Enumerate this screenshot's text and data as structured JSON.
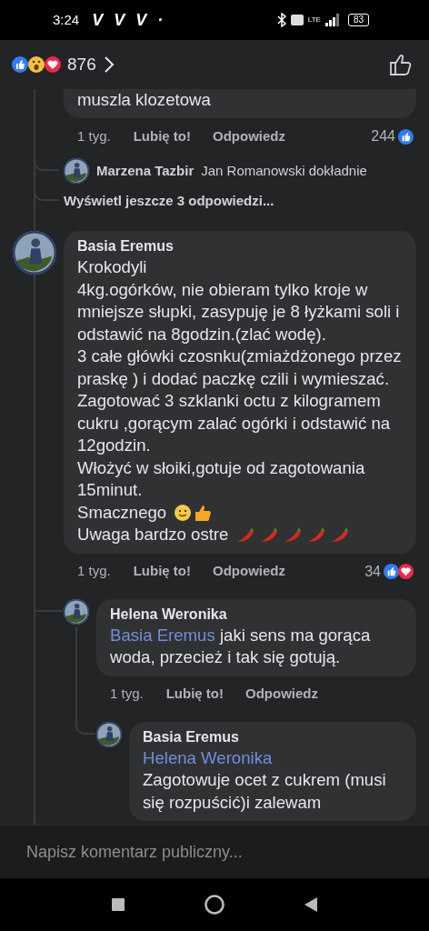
{
  "status_bar": {
    "time": "3:24",
    "notifications": [
      "V",
      "V",
      "V",
      "·"
    ],
    "battery": "83",
    "network": "LTE"
  },
  "header": {
    "reaction_count": "876"
  },
  "previous_replies": [
    {
      "kind": "tail",
      "lines": [
        {
          "text": "muszla klozetowa"
        }
      ],
      "time": "1 tyg.",
      "like": "Lubię to!",
      "reply": "Odpowiedz",
      "reactions_count": "244",
      "reactions": [
        {
          "kind": "like"
        }
      ]
    },
    {
      "kind": "inline",
      "author": "Marzena Tazbir",
      "text": "Jan Romanowski dokładnie"
    },
    {
      "kind": "more",
      "text": "Wyświetl jeszcze 3 odpowiedzi..."
    }
  ],
  "comments": [
    {
      "kind": "full",
      "author": "Basia Eremus",
      "lines": [
        {
          "text": "Krokodyli"
        },
        {
          "text": "4kg.ogórków, nie obieram tylko kroje w mniejsze słupki, zasypuję je 8 łyżkami soli i odstawić na 8godzin.(zlać wodę)."
        },
        {
          "text": "3 całe główki czosnku(zmiażdżonego przez praskę ) i dodać paczkę czili i wymieszać."
        },
        {
          "text": "Zagotować 3 szklanki octu z kilogramem cukru ,gorącym zalać ogórki i odstawić na 12godzin."
        },
        {
          "text": "Włożyć w słoiki,gotuje od zagotowania 15minut."
        },
        {
          "text": "Smacznego",
          "emoji": [
            {
              "kind": "smile"
            },
            {
              "kind": "thumbs_up"
            }
          ]
        },
        {
          "text": "Uwaga bardzo ostre",
          "emoji": [
            {
              "kind": "chili"
            },
            {
              "kind": "chili"
            },
            {
              "kind": "chili"
            },
            {
              "kind": "chili"
            },
            {
              "kind": "chili"
            }
          ]
        }
      ],
      "time": "1 tyg.",
      "like": "Lubię to!",
      "reply": "Odpowiedz",
      "reactions_count": "34",
      "reactions": [
        {
          "kind": "like"
        },
        {
          "kind": "love"
        }
      ],
      "children": [
        {
          "kind": "full",
          "author": "Helena Weronika",
          "lines": [
            {
              "mention": "Basia Eremus",
              "text": "jaki sens ma gorąca woda, przecież i tak się gotują."
            }
          ],
          "time": "1 tyg.",
          "like": "Lubię to!",
          "reply": "Odpowiedz",
          "children": [
            {
              "kind": "full",
              "author": "Basia Eremus",
              "lines": [
                {
                  "mention": "Helena Weronika"
                },
                {
                  "text": "Zagotowuje ocet z cukrem (musi się rozpuścić)i zalewam"
                }
              ]
            }
          ]
        }
      ]
    }
  ],
  "composer": {
    "placeholder": "Napisz komentarz publiczny..."
  }
}
